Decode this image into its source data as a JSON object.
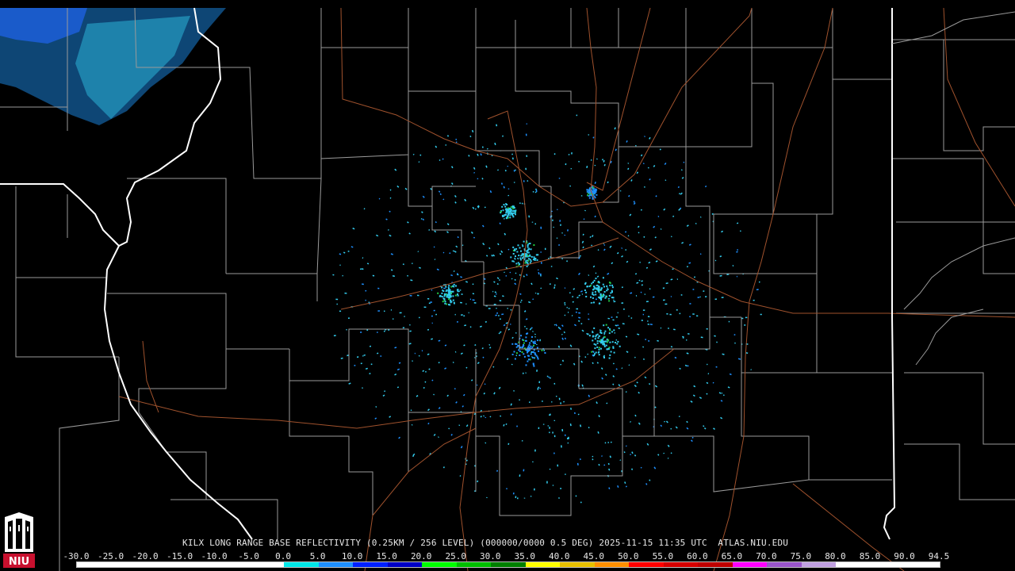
{
  "caption": "KILX LONG RANGE BASE REFLECTIVITY (0.25KM / 256 LEVEL) (000000/0000 0.5 DEG) 2025-11-15 11:35 UTC  ATLAS.NIU.EDU",
  "logo_text": "NIU",
  "scale": {
    "ticks": [
      "-30.0",
      "-25.0",
      "-20.0",
      "-15.0",
      "-10.0",
      "-5.0",
      "0.0",
      "5.0",
      "10.0",
      "15.0",
      "20.0",
      "25.0",
      "30.0",
      "35.0",
      "40.0",
      "45.0",
      "50.0",
      "55.0",
      "60.0",
      "65.0",
      "70.0",
      "75.0",
      "80.0",
      "85.0",
      "90.0",
      "94.5"
    ],
    "colors": [
      "#ffffff",
      "#ffffff",
      "#ffffff",
      "#ffffff",
      "#ffffff",
      "#ffffff",
      "#00e8e8",
      "#1e90ff",
      "#0020ff",
      "#0000c8",
      "#00ff00",
      "#00c000",
      "#008000",
      "#ffff00",
      "#e7c000",
      "#ff9000",
      "#ff0000",
      "#d60000",
      "#c00000",
      "#ff00ff",
      "#9955c9",
      "#c0a0e0",
      "#ffffff",
      "#ffffff",
      "#ffffff",
      "#ffffff"
    ]
  },
  "colors": {
    "background": "#000000",
    "county_lines": "#9a9a9a",
    "state_lines": "#ffffff",
    "highways": "#a0522d",
    "echo_light": "#33ccee",
    "echo_mid": "#1e90ff",
    "echo_green": "#22cc44"
  }
}
